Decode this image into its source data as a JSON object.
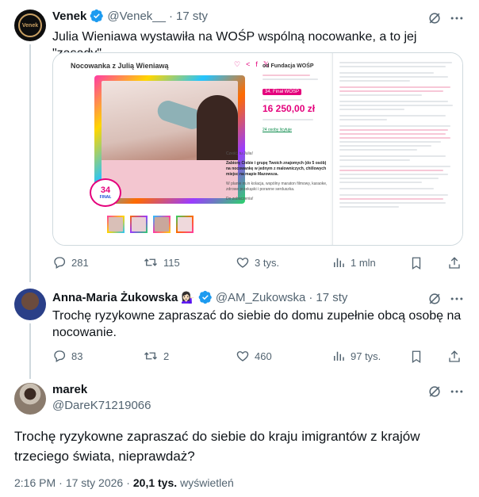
{
  "tweet1": {
    "author_name": "Venek",
    "handle": "@Venek__",
    "separator": "·",
    "date": "17 sty",
    "text": "Julia Wieniawa wystawiła na WOŚP wspólną nocowanke, a to jej \"zasady\"",
    "stats": {
      "replies": "281",
      "retweets": "115",
      "likes": "3 tys.",
      "views": "1 mln"
    },
    "card": {
      "heading": "Nocowanka z Julią Wieniawą",
      "fundraiser_label": "od Fundacja WOŚP",
      "badge": "34. Finał WOŚP",
      "amount": "16 250,00 zł",
      "link_text": "24 osoby licytuje",
      "greeting": "Cześć, tu Julia!",
      "body_bold": "Zabiorę Ciebie i grupę Twoich znajomych (do 5 osób) na nocowankę w jednym z malowniczych, chillowych miejsc na mapie Mazowsza.",
      "body_plan": "W planie m.in kolacja, wspólny maraton filmowy, karaoke, zdrowe przekąski i poranne serduszka.",
      "farewell": "Do zobaczenia!",
      "logo_number": "34",
      "logo_word": "FINAŁ"
    }
  },
  "tweet2": {
    "author_name": "Anna-Maria Żukowska",
    "emoji": "💁🏻‍♀️",
    "handle": "@AM_Zukowska",
    "separator": "·",
    "date": "17 sty",
    "text": "Trochę ryzykowne zapraszać do siebie do domu zupełnie obcą osobę na nocowanie.",
    "stats": {
      "replies": "83",
      "retweets": "2",
      "likes": "460",
      "views": "97 tys."
    }
  },
  "tweet3": {
    "author_name": "marek",
    "handle": "@DareK71219066",
    "text": "Trochę ryzykowne zapraszać do siebie do kraju imigrantów z krajów trzeciego świata, nieprawdaż?",
    "time": "2:16 PM",
    "separator": "·",
    "date": "17 sty 2026",
    "views_count": "20,1 tys.",
    "views_label": "wyświetleń"
  },
  "colors": {
    "verified": "#1d9bf0",
    "muted": "#536471",
    "line": "#cfd9de",
    "pink": "#e4007c"
  }
}
